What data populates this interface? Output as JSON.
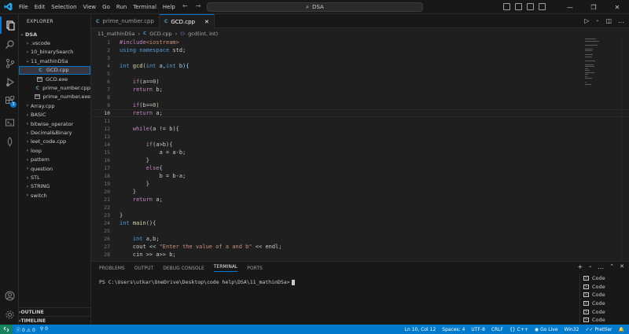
{
  "titlebar": {
    "menu": [
      "File",
      "Edit",
      "Selection",
      "View",
      "Go",
      "Run",
      "Terminal",
      "Help"
    ],
    "search": "DSA"
  },
  "sidebar": {
    "header": "EXPLORER",
    "root": "DSA",
    "items": [
      {
        "label": ".vscode",
        "type": "folder",
        "indent": 1,
        "open": false
      },
      {
        "label": "10_binarySearch",
        "type": "folder",
        "indent": 1,
        "open": false
      },
      {
        "label": "11_mathinDSa",
        "type": "folder",
        "indent": 1,
        "open": true
      },
      {
        "label": "GCD.cpp",
        "type": "cpp",
        "indent": 2,
        "selected": true
      },
      {
        "label": "GCD.exe",
        "type": "exe",
        "indent": 2
      },
      {
        "label": "prime_number.cpp",
        "type": "cpp",
        "indent": 2
      },
      {
        "label": "prime_number.exe",
        "type": "exe",
        "indent": 2
      },
      {
        "label": "Array.cpp",
        "type": "folder",
        "indent": 1,
        "open": false
      },
      {
        "label": "BASIC",
        "type": "folder",
        "indent": 1,
        "open": false
      },
      {
        "label": "bitwise_operator",
        "type": "folder",
        "indent": 1,
        "open": false
      },
      {
        "label": "Decimal&Binary",
        "type": "folder",
        "indent": 1,
        "open": false
      },
      {
        "label": "leet_code.cpp",
        "type": "folder",
        "indent": 1,
        "open": false
      },
      {
        "label": "loop",
        "type": "folder",
        "indent": 1,
        "open": false
      },
      {
        "label": "pattern",
        "type": "folder",
        "indent": 1,
        "open": false
      },
      {
        "label": "question",
        "type": "folder",
        "indent": 1,
        "open": false
      },
      {
        "label": "STL",
        "type": "folder",
        "indent": 1,
        "open": false
      },
      {
        "label": "STRING",
        "type": "folder",
        "indent": 1,
        "open": false
      },
      {
        "label": "switch",
        "type": "folder",
        "indent": 1,
        "open": false
      }
    ],
    "outline": "OUTLINE",
    "timeline": "TIMELINE"
  },
  "activity": {
    "extensions_badge": "3"
  },
  "tabs": [
    {
      "label": "prime_number.cpp",
      "active": false
    },
    {
      "label": "GCD.cpp",
      "active": true
    }
  ],
  "breadcrumb": {
    "folder": "11_mathinDSa",
    "file": "GCD.cpp",
    "symbol": "gcd(int, int)"
  },
  "editor": {
    "current_line": 10,
    "lines": [
      [
        {
          "t": "#include",
          "c": "inc"
        },
        {
          "t": "<iostream>",
          "c": "str"
        }
      ],
      [
        {
          "t": "using ",
          "c": "kw"
        },
        {
          "t": "namespace ",
          "c": "kw"
        },
        {
          "t": "std;",
          "c": ""
        }
      ],
      [],
      [
        {
          "t": "int ",
          "c": "kw"
        },
        {
          "t": "gcd",
          "c": "fn"
        },
        {
          "t": "(",
          "c": ""
        },
        {
          "t": "int ",
          "c": "kw"
        },
        {
          "t": "a,",
          "c": "var"
        },
        {
          "t": "int ",
          "c": "kw"
        },
        {
          "t": "b){",
          "c": "var"
        }
      ],
      [],
      [
        {
          "t": "    ",
          "c": ""
        },
        {
          "t": "if",
          "c": "ctl"
        },
        {
          "t": "(a==",
          "c": ""
        },
        {
          "t": "0",
          "c": "num"
        },
        {
          "t": ")",
          "c": ""
        }
      ],
      [
        {
          "t": "    ",
          "c": ""
        },
        {
          "t": "return ",
          "c": "ctl"
        },
        {
          "t": "b;",
          "c": ""
        }
      ],
      [],
      [
        {
          "t": "    ",
          "c": ""
        },
        {
          "t": "if",
          "c": "ctl"
        },
        {
          "t": "(b==",
          "c": ""
        },
        {
          "t": "0",
          "c": "num"
        },
        {
          "t": ")",
          "c": ""
        }
      ],
      [
        {
          "t": "    ",
          "c": ""
        },
        {
          "t": "return ",
          "c": "ctl"
        },
        {
          "t": "a;",
          "c": ""
        }
      ],
      [],
      [
        {
          "t": "    ",
          "c": ""
        },
        {
          "t": "while",
          "c": "ctl"
        },
        {
          "t": "(a != b){",
          "c": ""
        }
      ],
      [],
      [
        {
          "t": "        ",
          "c": ""
        },
        {
          "t": "if",
          "c": "ctl"
        },
        {
          "t": "(a>b){",
          "c": ""
        }
      ],
      [
        {
          "t": "            ",
          "c": ""
        },
        {
          "t": "a = a-b;",
          "c": ""
        }
      ],
      [
        {
          "t": "        }",
          "c": ""
        }
      ],
      [
        {
          "t": "        ",
          "c": ""
        },
        {
          "t": "else",
          "c": "ctl"
        },
        {
          "t": "{",
          "c": ""
        }
      ],
      [
        {
          "t": "            ",
          "c": ""
        },
        {
          "t": "b = b-a;",
          "c": ""
        }
      ],
      [
        {
          "t": "        }",
          "c": ""
        }
      ],
      [
        {
          "t": "    }",
          "c": ""
        }
      ],
      [
        {
          "t": "    ",
          "c": ""
        },
        {
          "t": "return ",
          "c": "ctl"
        },
        {
          "t": "a;",
          "c": ""
        }
      ],
      [],
      [
        {
          "t": "}",
          "c": ""
        }
      ],
      [
        {
          "t": "int ",
          "c": "kw"
        },
        {
          "t": "main",
          "c": "fn"
        },
        {
          "t": "(){",
          "c": ""
        }
      ],
      [],
      [
        {
          "t": "    ",
          "c": ""
        },
        {
          "t": "int ",
          "c": "kw"
        },
        {
          "t": "a,b;",
          "c": ""
        }
      ],
      [
        {
          "t": "    cout << ",
          "c": ""
        },
        {
          "t": "\"Enter the value of a and b\"",
          "c": "str"
        },
        {
          "t": " << endl;",
          "c": ""
        }
      ],
      [
        {
          "t": "    cin >> a>> b;",
          "c": ""
        }
      ]
    ]
  },
  "panel": {
    "tabs": [
      "PROBLEMS",
      "OUTPUT",
      "DEBUG CONSOLE",
      "TERMINAL",
      "PORTS"
    ],
    "active_tab": "TERMINAL",
    "prompt": "PS C:\\Users\\utkar\\OneDrive\\Desktop\\code help\\DSA\\11_mathinDSa>",
    "terminals": [
      "Code",
      "Code",
      "Code",
      "Code",
      "Code",
      "Code"
    ]
  },
  "statusbar": {
    "errors": "0",
    "warnings": "0",
    "ports": "0",
    "position": "Ln 10, Col 12",
    "spaces": "Spaces: 4",
    "encoding": "UTF-8",
    "eol": "CRLF",
    "lang_braces": "{}",
    "language": "C++",
    "golive": "Go Live",
    "platform": "Win32",
    "prettier": "Prettier"
  }
}
